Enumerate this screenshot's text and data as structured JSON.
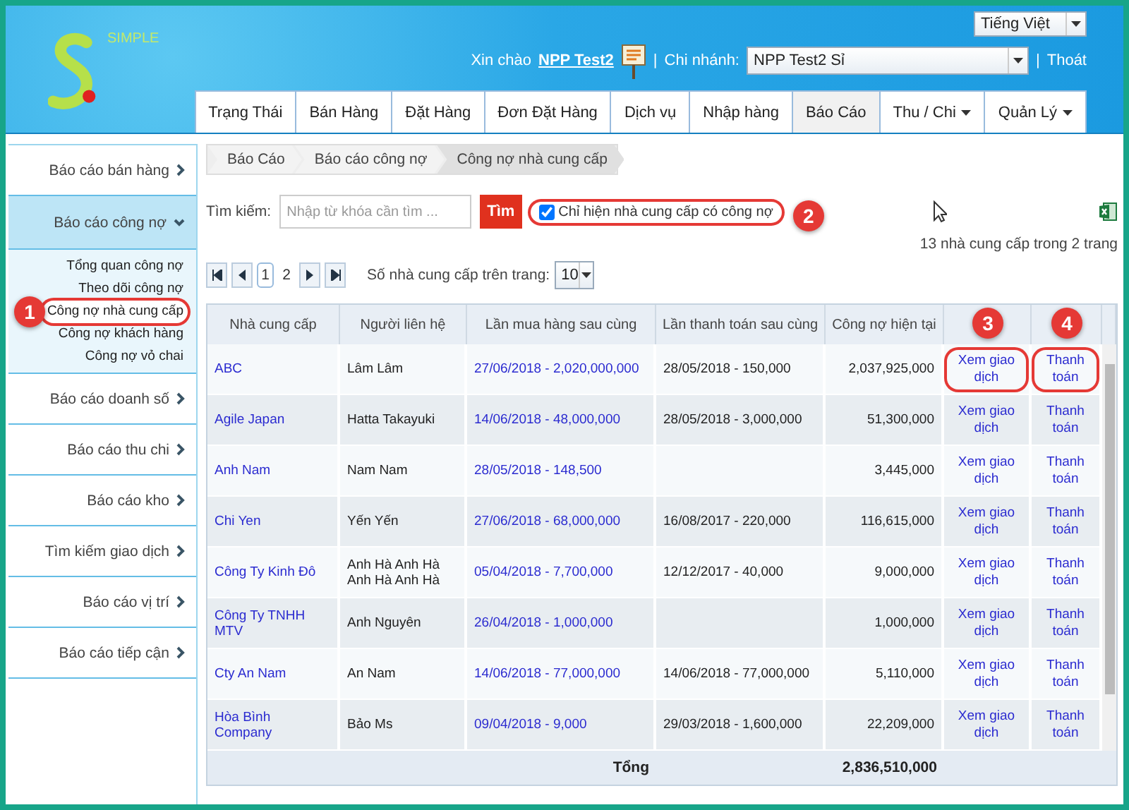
{
  "header": {
    "logo_text": "SIMPLE",
    "language": "Tiếng Việt",
    "greeting": "Xin chào",
    "user": "NPP Test2",
    "separators": [
      "|",
      "|"
    ],
    "branch_label": "Chi nhánh:",
    "branch": "NPP Test2 Sỉ",
    "logout": "Thoát"
  },
  "nav": [
    {
      "label": "Trạng Thái",
      "selected": false,
      "has_menu": false
    },
    {
      "label": "Bán Hàng",
      "selected": false,
      "has_menu": false
    },
    {
      "label": "Đặt Hàng",
      "selected": false,
      "has_menu": false
    },
    {
      "label": "Đơn Đặt Hàng",
      "selected": false,
      "has_menu": false
    },
    {
      "label": "Dịch vụ",
      "selected": false,
      "has_menu": false
    },
    {
      "label": "Nhập hàng",
      "selected": false,
      "has_menu": false
    },
    {
      "label": "Báo Cáo",
      "selected": true,
      "has_menu": false
    },
    {
      "label": "Thu / Chi",
      "selected": false,
      "has_menu": true
    },
    {
      "label": "Quản Lý",
      "selected": false,
      "has_menu": true
    }
  ],
  "sidebar": {
    "items": [
      {
        "label": "Báo cáo bán hàng",
        "expanded": false
      },
      {
        "label": "Báo cáo công nợ",
        "expanded": true,
        "children": [
          {
            "label": "Tổng quan công nợ",
            "selected": false
          },
          {
            "label": "Theo dõi công nợ",
            "selected": false
          },
          {
            "label": "Công nợ nhà cung cấp",
            "selected": true,
            "callout": "1"
          },
          {
            "label": "Công nợ khách hàng",
            "selected": false
          },
          {
            "label": "Công nợ vỏ chai",
            "selected": false
          }
        ]
      },
      {
        "label": "Báo cáo doanh số",
        "expanded": false
      },
      {
        "label": "Báo cáo thu chi",
        "expanded": false
      },
      {
        "label": "Báo cáo kho",
        "expanded": false
      },
      {
        "label": "Tìm kiếm giao dịch",
        "expanded": false
      },
      {
        "label": "Báo cáo vị trí",
        "expanded": false
      },
      {
        "label": "Báo cáo tiếp cận",
        "expanded": false
      }
    ]
  },
  "breadcrumb": [
    {
      "label": "Báo Cáo",
      "selected": false
    },
    {
      "label": "Báo cáo công nợ",
      "selected": false
    },
    {
      "label": "Công nợ nhà cung cấp",
      "selected": true
    }
  ],
  "search": {
    "label": "Tìm kiếm:",
    "placeholder": "Nhập từ khóa cần tìm ...",
    "button": "Tìm",
    "filter": {
      "label": "Chỉ hiện nhà cung cấp có công nợ",
      "checked": true,
      "callout": "2"
    }
  },
  "summary": "13 nhà cung cấp trong 2 trang",
  "pagination": {
    "pages": [
      {
        "label": "1",
        "selected": true
      },
      {
        "label": "2",
        "selected": false
      }
    ],
    "page_size_label": "Số nhà cung cấp trên trang:",
    "page_size": "10"
  },
  "table": {
    "columns": [
      "Nhà cung cấp",
      "Người liên hệ",
      "Lần mua hàng sau cùng",
      "Lần thanh toán sau cùng",
      "Công nợ hiện tại"
    ],
    "action_callouts": [
      "3",
      "4"
    ],
    "rows": [
      {
        "supplier": "ABC",
        "contact": "Lâm Lâm",
        "last_purchase": "27/06/2018 - 2,020,000,000",
        "last_payment": "28/05/2018 - 150,000",
        "debt": "2,037,925,000",
        "actions": [
          {
            "label": "Xem giao dịch",
            "circled": true
          },
          {
            "label": "Thanh toán",
            "circled": true
          }
        ]
      },
      {
        "supplier": "Agile Japan",
        "contact": "Hatta Takayuki",
        "last_purchase": "14/06/2018 - 48,000,000",
        "last_payment": "28/05/2018 - 3,000,000",
        "debt": "51,300,000",
        "actions": [
          {
            "label": "Xem giao dịch",
            "circled": false
          },
          {
            "label": "Thanh toán",
            "circled": false
          }
        ]
      },
      {
        "supplier": "Anh Nam",
        "contact": "Nam Nam",
        "last_purchase": "28/05/2018 - 148,500",
        "debt": "3,445,000",
        "actions": [
          {
            "label": "Xem giao dịch",
            "circled": false
          },
          {
            "label": "Thanh toán",
            "circled": false
          }
        ]
      },
      {
        "supplier": "Chi Yen",
        "contact": "Yến Yến",
        "last_purchase": "27/06/2018 - 68,000,000",
        "last_payment": "16/08/2017 - 220,000",
        "debt": "116,615,000",
        "actions": [
          {
            "label": "Xem giao dịch",
            "circled": false
          },
          {
            "label": "Thanh toán",
            "circled": false
          }
        ]
      },
      {
        "supplier": "Công Ty Kinh Đô",
        "contact": "Anh Hà Anh Hà Anh Hà Anh Hà",
        "last_purchase": "05/04/2018 - 7,700,000",
        "last_payment": "12/12/2017 - 40,000",
        "debt": "9,000,000",
        "actions": [
          {
            "label": "Xem giao dịch",
            "circled": false
          },
          {
            "label": "Thanh toán",
            "circled": false
          }
        ]
      },
      {
        "supplier": "Công Ty TNHH MTV",
        "contact": "Anh Nguyên",
        "last_purchase": "26/04/2018 - 1,000,000",
        "debt": "1,000,000",
        "actions": [
          {
            "label": "Xem giao dịch",
            "circled": false
          },
          {
            "label": "Thanh toán",
            "circled": false
          }
        ]
      },
      {
        "supplier": "Cty An Nam",
        "contact": "An Nam",
        "last_purchase": "14/06/2018 - 77,000,000",
        "last_payment": "14/06/2018 - 77,000,000",
        "debt": "5,110,000",
        "actions": [
          {
            "label": "Xem giao dịch",
            "circled": false
          },
          {
            "label": "Thanh toán",
            "circled": false
          }
        ]
      },
      {
        "supplier": "Hòa Bình Company",
        "contact": "Bảo Ms",
        "last_purchase": "09/04/2018 - 9,000",
        "last_payment": "29/03/2018 - 1,600,000",
        "debt": "22,209,000",
        "actions": [
          {
            "label": "Xem giao dịch",
            "circled": false
          },
          {
            "label": "Thanh toán",
            "circled": false
          }
        ]
      }
    ],
    "total_label": "Tổng",
    "total": "2,836,510,000"
  }
}
